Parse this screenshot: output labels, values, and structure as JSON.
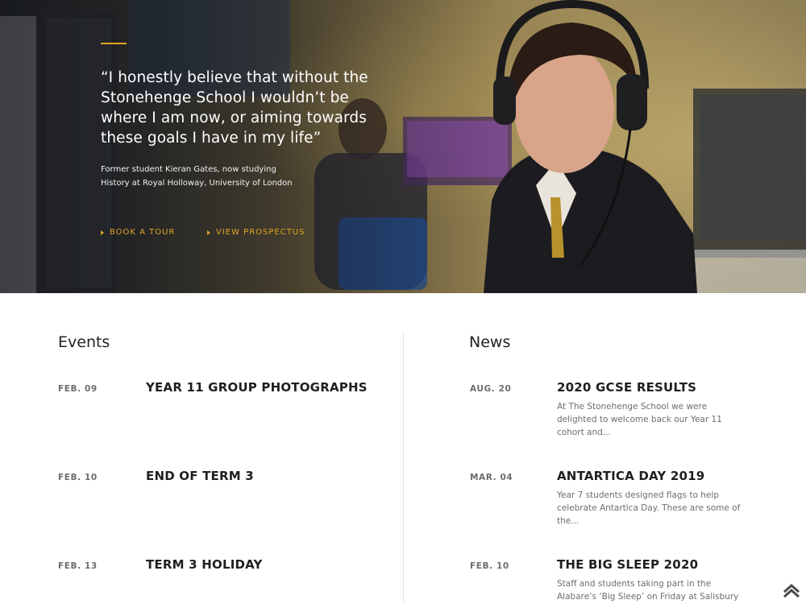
{
  "hero": {
    "quote": "“I honestly believe that without the Stonehenge School I wouldn’t be where I am now, or aiming towards these goals I have in my life”",
    "attribution_line1": "Former student Kieran Gates, now studying",
    "attribution_line2": "History at Royal Holloway, University of London",
    "cta_tour": "BOOK A TOUR",
    "cta_prospectus": "VIEW PROSPECTUS",
    "accent_color": "#e0a725"
  },
  "events": {
    "title": "Events",
    "items": [
      {
        "date": "FEB. 09",
        "title": "YEAR 11 GROUP PHOTOGRAPHS"
      },
      {
        "date": "FEB. 10",
        "title": "END OF TERM 3"
      },
      {
        "date": "FEB. 13",
        "title": "TERM 3 HOLIDAY"
      }
    ]
  },
  "news": {
    "title": "News",
    "items": [
      {
        "date": "AUG. 20",
        "title": "2020 GCSE RESULTS",
        "excerpt": "At The Stonehenge School we were delighted to welcome back our Year 11 cohort and..."
      },
      {
        "date": "MAR. 04",
        "title": "ANTARTICA DAY 2019",
        "excerpt": "Year 7 students designed flags to help celebrate Antartica Day.  These are some of the..."
      },
      {
        "date": "FEB. 10",
        "title": "THE BIG SLEEP 2020",
        "excerpt": "Staff and students taking part in the Alabare’s ‘Big Sleep’ on Friday at Salisbury Cathedral. ..."
      }
    ]
  },
  "icons": {
    "scroll_top": "chevron-up-icon",
    "cta_arrow": "triangle-right-icon"
  }
}
